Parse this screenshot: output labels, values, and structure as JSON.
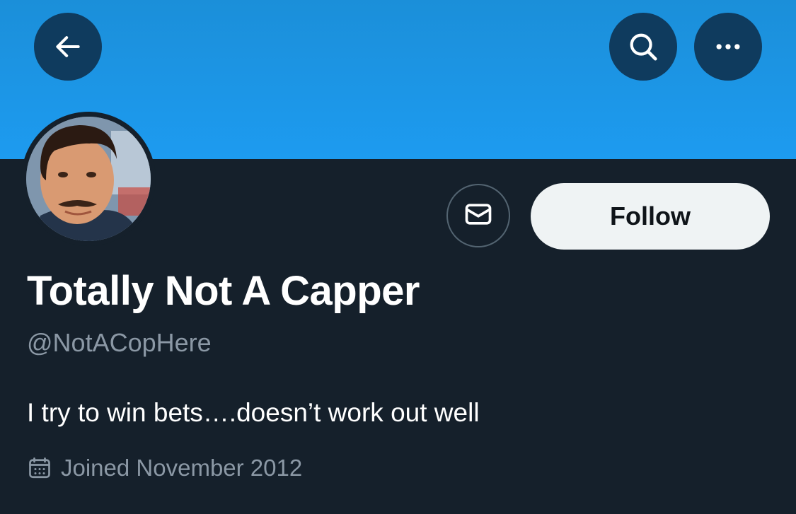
{
  "header": {
    "back_icon": "arrow-left-icon",
    "search_icon": "search-icon",
    "more_icon": "more-horizontal-icon",
    "banner_color": "#1d9bf0"
  },
  "profile": {
    "display_name": "Totally Not A Capper",
    "handle": "@NotACopHere",
    "bio": "I try to win bets….doesn’t work out well",
    "joined": "Joined November 2012",
    "joined_icon": "calendar-icon",
    "message_icon": "mail-icon"
  },
  "actions": {
    "follow_label": "Follow"
  },
  "colors": {
    "background": "#15202b",
    "secondary_text": "#8b98a5",
    "follow_bg": "#eff3f4"
  }
}
